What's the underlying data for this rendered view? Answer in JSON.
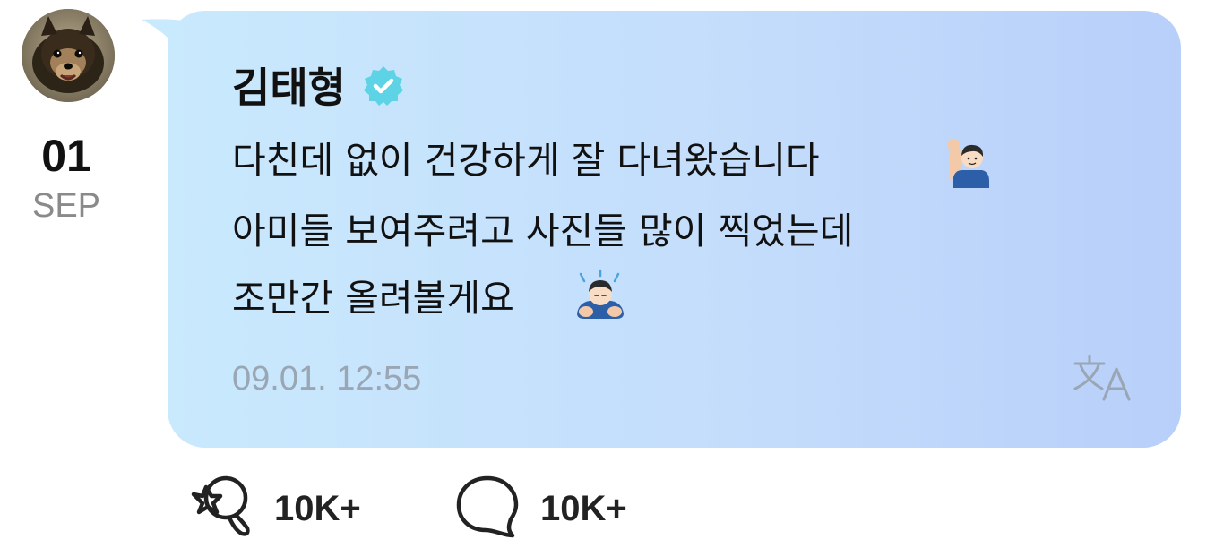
{
  "post": {
    "author": "김태형",
    "verified": true,
    "date": {
      "day": "01",
      "month": "SEP"
    },
    "message": {
      "line1": "다친데 없이 건강하게 잘 다녀왔습니다",
      "line2": "아미들 보여주려고 사진들 많이 찍었는데",
      "line3": "조만간 올려볼게요"
    },
    "emojis": [
      "person-raising-hand-emoji",
      "person-bowing-emoji"
    ],
    "timestamp": "09.01. 12:55"
  },
  "actions": {
    "likes": "10K+",
    "comments": "10K+"
  },
  "colors": {
    "bubble_start": "#c9e9fd",
    "bubble_end": "#b8cffa",
    "verified_badge": "#5fd3e6",
    "timestamp": "#9aa6b4"
  },
  "icons": [
    "avatar-dog-photo",
    "verified-badge-icon",
    "translate-icon",
    "like-icon",
    "comment-icon"
  ]
}
